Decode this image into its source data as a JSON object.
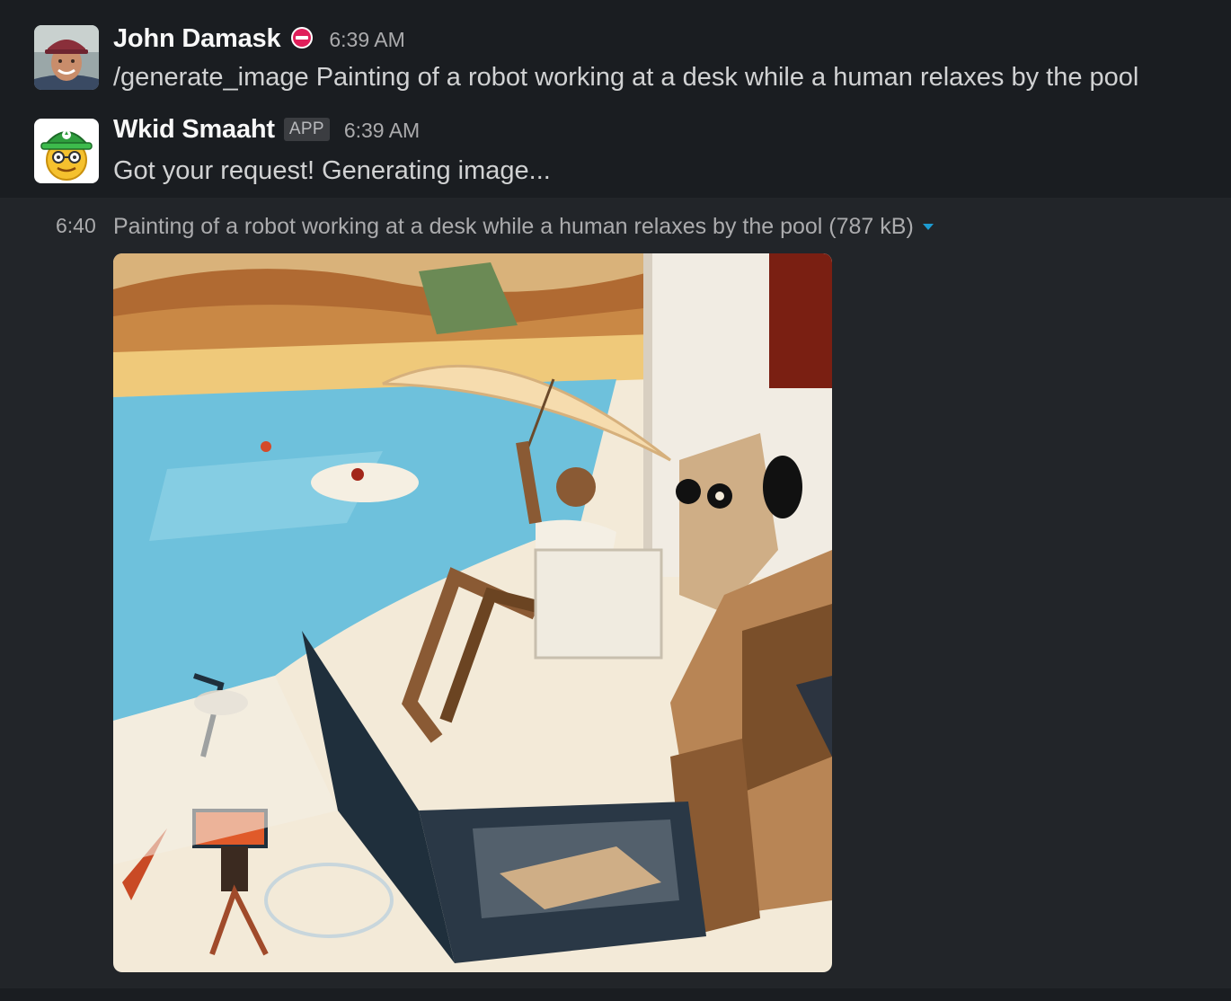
{
  "messages": [
    {
      "sender": "John Damask",
      "status_icon": "do-not-disturb-icon",
      "time": "6:39 AM",
      "text": "/generate_image Painting of a robot working at a desk while a human relaxes by the pool"
    },
    {
      "sender": "Wkid Smaaht",
      "badge": "APP",
      "time": "6:39 AM",
      "text": "Got your request! Generating image..."
    }
  ],
  "attachment": {
    "time": "6:40",
    "title": "Painting of a robot working at a desk while a human relaxes by the pool (787 kB)",
    "menu_icon": "caret-down-icon"
  },
  "colors": {
    "background": "#1a1d21",
    "hover_background": "#222529",
    "accent": "#1d9bd1",
    "dnd_red": "#e01e5a"
  }
}
